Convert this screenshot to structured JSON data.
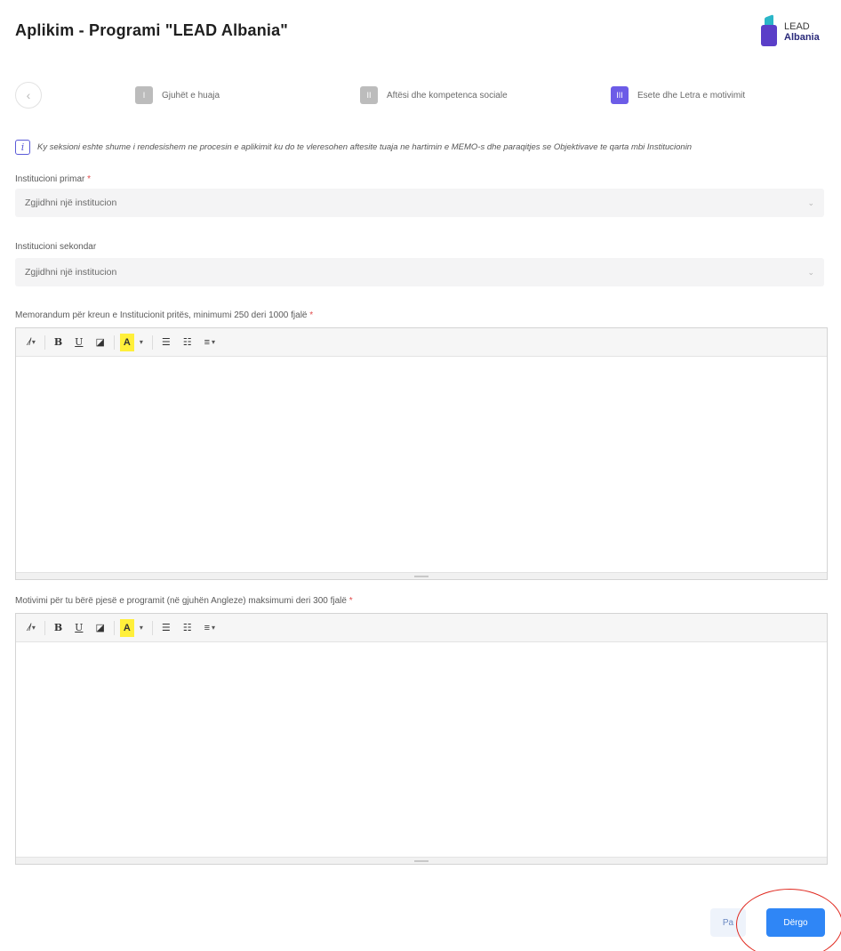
{
  "header": {
    "title": "Aplikim - Programi \"LEAD Albania\"",
    "logo_line1": "LEAD",
    "logo_line2": "Albania"
  },
  "steps": [
    {
      "num": "I",
      "label": "Gjuhët e huaja",
      "active": false
    },
    {
      "num": "II",
      "label": "Aftësi dhe kompetenca sociale",
      "active": false
    },
    {
      "num": "III",
      "label": "Esete dhe Letra e motivimit",
      "active": true
    }
  ],
  "info": {
    "icon": "info-icon",
    "text": "Ky seksioni eshte shume i rendesishem ne procesin e aplikimit ku do te vleresohen aftesite tuaja ne hartimin e MEMO-s dhe paraqitjes se Objektivave te qarta mbi Institucionin"
  },
  "fields": {
    "primary_label": "Institucioni primar",
    "primary_placeholder": "Zgjidhni një institucion",
    "secondary_label": "Institucioni sekondar",
    "secondary_placeholder": "Zgjidhni një institucion",
    "memo_label": "Memorandum për kreun e Institucionit pritës, minimumi 250 deri 1000 fjalë",
    "motivation_label": "Motivimi për tu bërë pjesë e programit (në gjuhën Angleze) maksimumi deri 300 fjalë",
    "required_mark": "*"
  },
  "toolbar": {
    "style_label": "⁄̸",
    "bold": "B",
    "underline": "U",
    "eraser": "⌫",
    "color": "A",
    "caret": "▾"
  },
  "buttons": {
    "prev_label": "Pa",
    "send_label": "Dërgo"
  },
  "colors": {
    "accent": "#6c5ce7",
    "primary_button": "#2f86f6",
    "annotation_circle": "#e0281e"
  }
}
